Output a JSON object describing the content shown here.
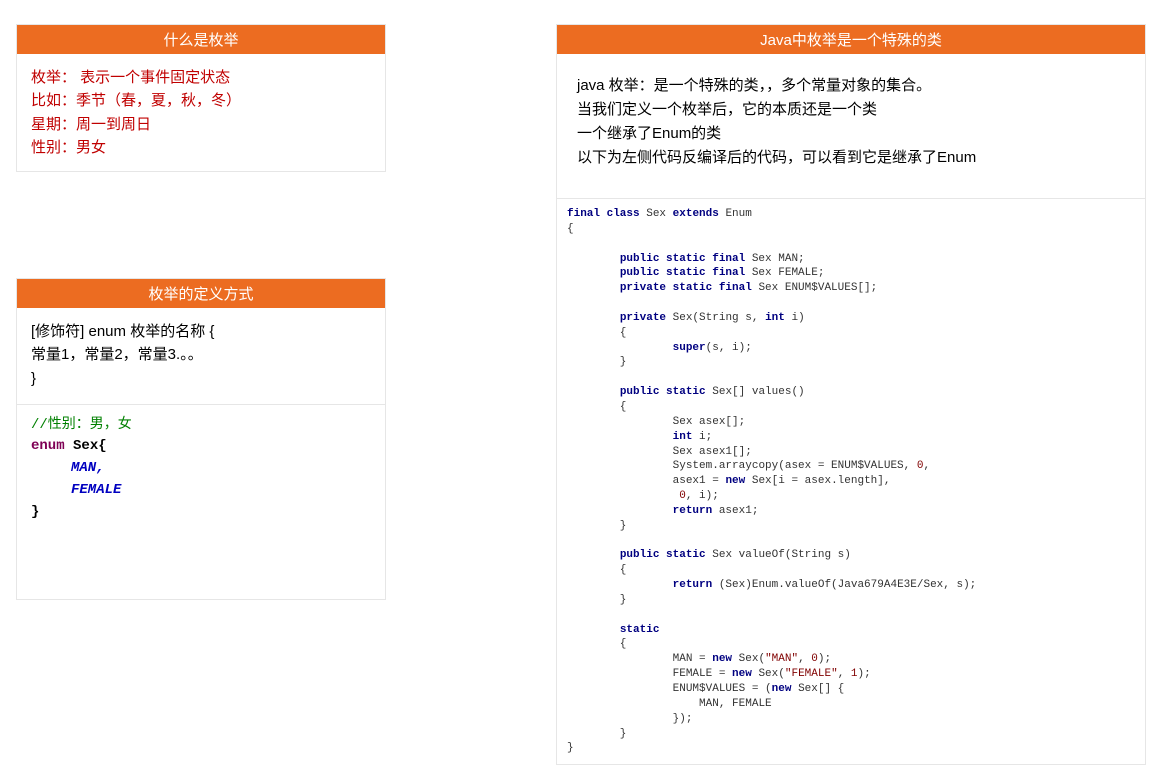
{
  "box1": {
    "title": "什么是枚举",
    "l1": "枚举：  表示一个事件固定状态",
    "l2": "比如：季节（春，夏，秋，冬）",
    "l3": "星期：周一到周日",
    "l4": "性别：男女"
  },
  "box2": {
    "title": "枚举的定义方式",
    "def1": "[修饰符] enum 枚举的名称   {",
    "def2": " 常量1，常量2，常量3.。。",
    "def3": " }",
    "comment": "//性别：男，女",
    "kw_enum": "enum",
    "cls": " Sex{",
    "c1": "MAN,",
    "c2": "FEMALE",
    "close": "}"
  },
  "box3": {
    "title": "Java中枚举是一个特殊的类",
    "p1": "java 枚举：是一个特殊的类，，多个常量对象的集合。",
    "p2": "当我们定义一个枚举后，它的本质还是一个类",
    "p3": "一个继承了Enum的类",
    "p4": "以下为左侧代码反编译后的代码，可以看到它是继承了Enum",
    "code": {
      "kw_final_class": "final class",
      "sex": " Sex ",
      "kw_extends": "extends",
      "enum": " Enum",
      "kw_psf": "public static final",
      "sex_man": " Sex MAN;",
      "sex_female": " Sex FEMALE;",
      "kw_prsf": "private static final",
      "enum_values": " Sex ENUM$VALUES[];",
      "kw_private": "private",
      "ctor_sig": " Sex(String s, ",
      "kw_int": "int",
      "ctor_sig2": " i)",
      "kw_super": "super",
      "super_call": "(s, i);",
      "kw_ps": "public static",
      "values_sig": " Sex[] values()",
      "v1": "Sex asex[];",
      "v2_a": " i;",
      "v3": "Sex asex1[];",
      "v4a": "System.arraycopy(asex = ENUM$VALUES, ",
      "v4b": ",",
      "v5a": "asex1 = ",
      "kw_new": "new",
      "v5b": " Sex[i = asex.length],",
      "v6a": " ",
      "v6b": ", i);",
      "kw_return": "return",
      "v7": " asex1;",
      "valueof_sig": " Sex valueOf(String s)",
      "vo_ret": " (Sex)Enum.valueOf(Java679A4E3E/Sex, s);",
      "kw_static": "static",
      "s1a": "MAN = ",
      "s1b": " Sex(",
      "str_man": "\"MAN\"",
      "s1c": ", ",
      "s1d": ");",
      "s2a": "FEMALE = ",
      "str_female": "\"FEMALE\"",
      "s2c": ", ",
      "s3a": "ENUM$VALUES = (",
      "s3b": " Sex[] {",
      "s4": "    MAN, FEMALE",
      "s5": "});",
      "n0": "0",
      "n1": "1"
    }
  }
}
